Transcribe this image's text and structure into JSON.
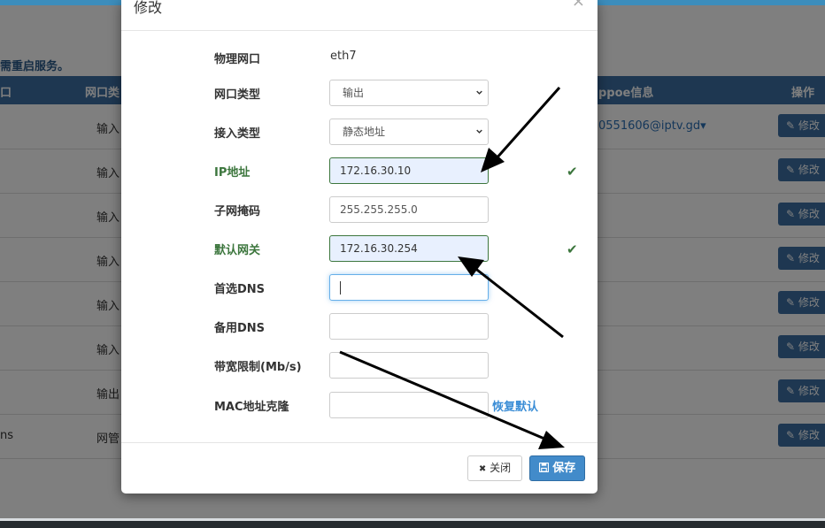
{
  "background": {
    "notice": "需重启服务。",
    "table": {
      "headers": [
        "口",
        "网口类",
        "ppoe信息",
        "操作"
      ],
      "rows": [
        {
          "name": "",
          "type": "输入",
          "pppoe": "0551606@iptv.gd▾"
        },
        {
          "name": "",
          "type": "输入",
          "pppoe": ""
        },
        {
          "name": "",
          "type": "输入",
          "pppoe": ""
        },
        {
          "name": "",
          "type": "输入",
          "pppoe": ""
        },
        {
          "name": "",
          "type": "输入",
          "pppoe": ""
        },
        {
          "name": "",
          "type": "输入",
          "pppoe": ""
        },
        {
          "name": "",
          "type": "输出",
          "pppoe": ""
        },
        {
          "name": "ns",
          "type": "网管",
          "pppoe": ""
        }
      ],
      "edit_label": "修改"
    }
  },
  "modal": {
    "title": "修改",
    "close_x": "×",
    "fields": {
      "physical_port": {
        "label": "物理网口",
        "value": "eth7"
      },
      "port_type": {
        "label": "网口类型",
        "value": "输出"
      },
      "access_type": {
        "label": "接入类型",
        "value": "静态地址"
      },
      "ip": {
        "label": "IP地址",
        "value": "172.16.30.10"
      },
      "netmask": {
        "label": "子网掩码",
        "value": "255.255.255.0"
      },
      "gateway": {
        "label": "默认网关",
        "value": "172.16.30.254"
      },
      "dns1": {
        "label": "首选DNS",
        "value": ""
      },
      "dns2": {
        "label": "备用DNS",
        "value": ""
      },
      "bandwidth": {
        "label": "带宽限制(Mb/s)",
        "value": ""
      },
      "mac": {
        "label": "MAC地址克隆",
        "value": "",
        "restore": "恢复默认"
      }
    },
    "buttons": {
      "close": "关闭",
      "save": "保存"
    }
  },
  "colors": {
    "primary": "#428bca",
    "success": "#3c763d",
    "header": "#3c6fa3"
  },
  "icons": {
    "check": "✔",
    "close": "✖",
    "save": "floppy-disk-icon",
    "edit": "pencil-square-icon"
  }
}
